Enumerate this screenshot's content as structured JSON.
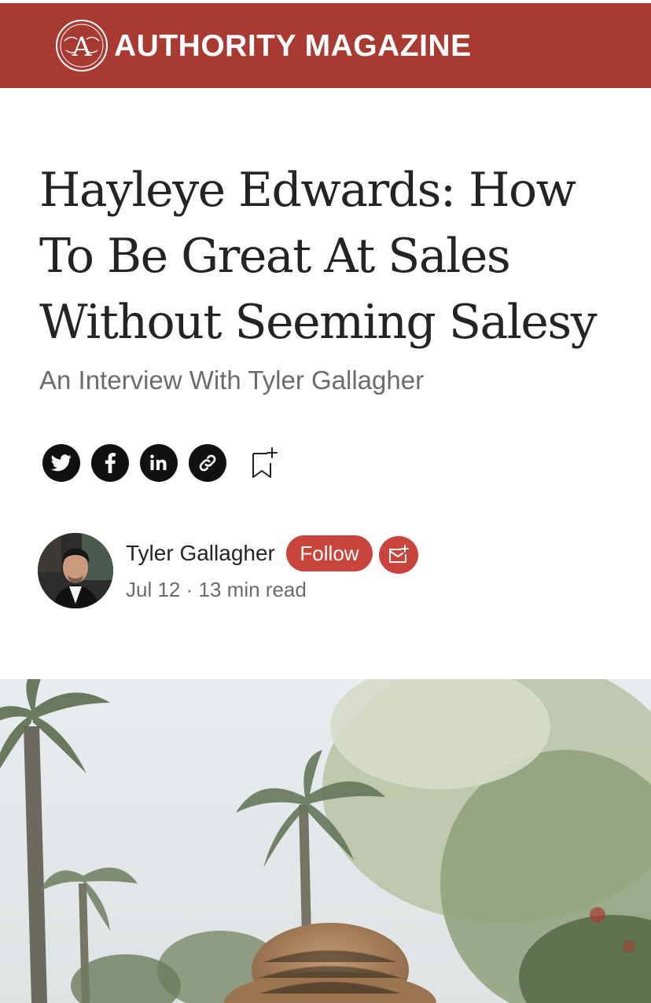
{
  "header": {
    "brand_name": "AUTHORITY MAGAZINE",
    "logo_letter": "A",
    "colors": {
      "background": "#a83a32",
      "text": "#ffffff"
    }
  },
  "article": {
    "title": "Hayleye Edwards: How To Be Great At Sales Without Seeming Salesy",
    "subtitle": "An Interview With Tyler Gallagher"
  },
  "share": {
    "buttons": [
      {
        "icon": "twitter-icon"
      },
      {
        "icon": "facebook-icon"
      },
      {
        "icon": "linkedin-icon"
      },
      {
        "icon": "link-icon"
      }
    ],
    "bookmark_icon": "bookmark-add-icon"
  },
  "author": {
    "name": "Tyler Gallagher",
    "follow_label": "Follow",
    "subscribe_icon": "email-subscribe-icon",
    "date": "Jul 12",
    "separator": "·",
    "read_time": "13 min read",
    "accent_color": "#c9453c"
  }
}
